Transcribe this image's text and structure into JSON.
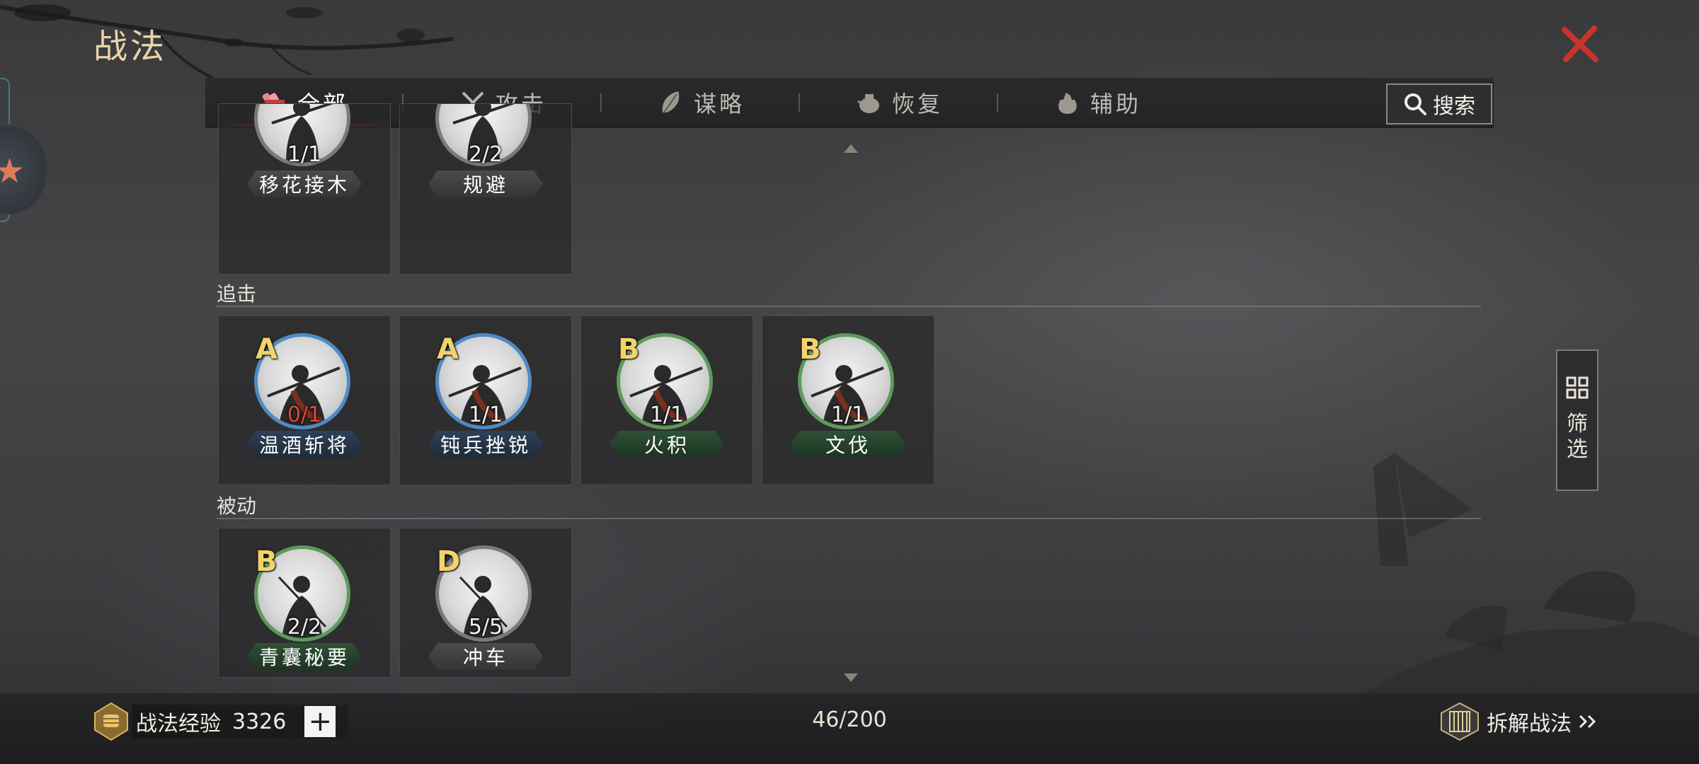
{
  "page": {
    "title": "战法"
  },
  "tabs": [
    {
      "label": "全部",
      "icon": "scroll-bundle-icon",
      "active": true
    },
    {
      "label": "攻击",
      "icon": "crossed-swords-icon",
      "active": false
    },
    {
      "label": "谋略",
      "icon": "feather-fan-icon",
      "active": false
    },
    {
      "label": "恢复",
      "icon": "medicine-pot-icon",
      "active": false
    },
    {
      "label": "辅助",
      "icon": "pouch-icon",
      "active": false
    }
  ],
  "search": {
    "label": "搜索"
  },
  "sections": {
    "top": {
      "cards": [
        {
          "name": "移花接木",
          "count": "1/1",
          "grade": "",
          "plate": "gray"
        },
        {
          "name": "规避",
          "count": "2/2",
          "grade": "",
          "plate": "gray"
        }
      ]
    },
    "pursuit": {
      "label": "追击",
      "cards": [
        {
          "name": "温酒斩将",
          "count": "0/1",
          "grade": "A",
          "plate": "blue"
        },
        {
          "name": "钝兵挫锐",
          "count": "1/1",
          "grade": "A",
          "plate": "blue"
        },
        {
          "name": "火积",
          "count": "1/1",
          "grade": "B",
          "plate": "green"
        },
        {
          "name": "文伐",
          "count": "1/1",
          "grade": "B",
          "plate": "green"
        }
      ]
    },
    "passive": {
      "label": "被动",
      "cards": [
        {
          "name": "青囊秘要",
          "count": "2/2",
          "grade": "B",
          "plate": "green"
        },
        {
          "name": "冲车",
          "count": "5/5",
          "grade": "D",
          "plate": "gray"
        }
      ]
    }
  },
  "filter": {
    "label": "筛选"
  },
  "footer": {
    "exp_label": "战法经验",
    "exp_value": "3326",
    "plus": "+",
    "capacity": "46/200",
    "dismantle": "拆解战法"
  },
  "colors": {
    "accent_gold": "#e9d7a8",
    "active_tab_red": "#e03a2a",
    "grade_yellow": "#f2d36b",
    "close_red": "#c8342c",
    "count_red": "#e04a3a"
  }
}
